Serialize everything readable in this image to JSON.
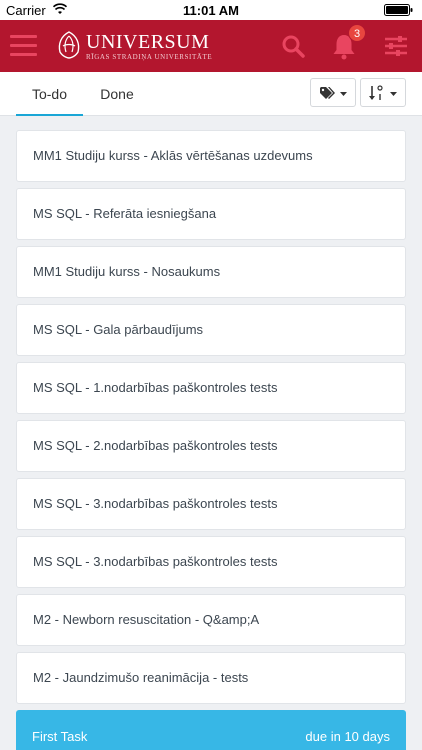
{
  "status_bar": {
    "carrier": "Carrier",
    "time": "11:01 AM"
  },
  "header": {
    "logo_name": "UNIVERSUM",
    "logo_subtitle": "RĪGAS STRADIŅA UNIVERSITĀTE",
    "notification_count": "3",
    "colors": {
      "header_bg": "#b3162e",
      "icon": "#e94560",
      "badge": "#e8463f"
    }
  },
  "tabs": [
    {
      "label": "To-do",
      "active": true
    },
    {
      "label": "Done",
      "active": false
    }
  ],
  "toolbar": {
    "tag_filter_icon": "tags-icon",
    "sort_icon": "sort-numeric-icon"
  },
  "tasks": [
    {
      "title": "MM1 Studiju kurss - Aklās vērtēšanas uzdevums"
    },
    {
      "title": "MS SQL - Referāta iesniegšana"
    },
    {
      "title": "MM1 Studiju kurss - Nosaukums"
    },
    {
      "title": "MS SQL - Gala pārbaudījums"
    },
    {
      "title": "MS SQL - 1.nodarbības paškontroles tests"
    },
    {
      "title": "MS SQL - 2.nodarbības paškontroles tests"
    },
    {
      "title": "MS SQL - 3.nodarbības paškontroles tests"
    },
    {
      "title": "MS SQL - 3.nodarbības paškontroles tests"
    },
    {
      "title": "M2 - Newborn resuscitation - Q&amp;A"
    },
    {
      "title": "M2 - Jaundzimušo reanimācija - tests"
    }
  ],
  "highlight_task": {
    "title": "First Task",
    "due": "due in 10 days",
    "color": "#37b7e6"
  }
}
